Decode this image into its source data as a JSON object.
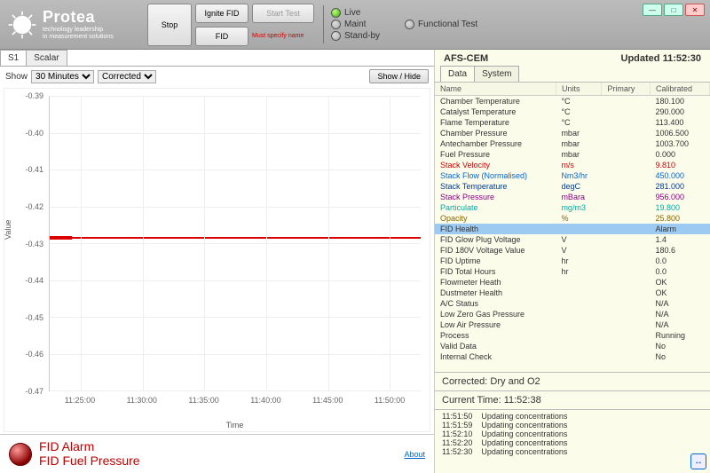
{
  "brand": {
    "title": "Protea",
    "sub1": "technology leadership",
    "sub2": "in measurement solutions"
  },
  "toolbar": {
    "stop": "Stop",
    "ignite": "Ignite FID",
    "start": "Start Test",
    "fid": "FID",
    "warn": "Must specify name"
  },
  "status": {
    "live": "Live",
    "maint": "Maint",
    "standby": "Stand-by",
    "func": "Functional Test"
  },
  "left": {
    "tabs": [
      "S1",
      "Scalar"
    ],
    "show_label": "Show",
    "time_range": "30 Minutes",
    "correction": "Corrected",
    "showhide": "Show / Hide",
    "about": "About"
  },
  "alarm": {
    "line1": "FID Alarm",
    "line2": "FID Fuel Pressure"
  },
  "chart_data": {
    "type": "line",
    "xlabel": "Time",
    "ylabel": "Value",
    "ylim": [
      -0.48,
      -0.39
    ],
    "yticks": [
      "-0.39",
      "-0.40",
      "-0.41",
      "-0.42",
      "-0.43",
      "-0.44",
      "-0.45",
      "-0.46",
      "-0.47"
    ],
    "xticks": [
      "11:25:00",
      "11:30:00",
      "11:35:00",
      "11:40:00",
      "11:45:00",
      "11:50:00"
    ],
    "series": [
      {
        "name": "S1",
        "color": "#d00",
        "constant_y": -0.433
      }
    ]
  },
  "right": {
    "title": "AFS-CEM",
    "updated_label": "Updated",
    "updated_time": "11:52:30",
    "tabs": [
      "Data",
      "System"
    ],
    "headers": [
      "Name",
      "Units",
      "Primary",
      "Calibrated"
    ],
    "rows": [
      {
        "n": "Chamber Temperature",
        "u": "°C",
        "v": "180.100",
        "cls": ""
      },
      {
        "n": "Catalyst Temperature",
        "u": "°C",
        "v": "290.000",
        "cls": ""
      },
      {
        "n": "Flame Temperature",
        "u": "°C",
        "v": "113.400",
        "cls": ""
      },
      {
        "n": "Chamber Pressure",
        "u": "mbar",
        "v": "1006.500",
        "cls": ""
      },
      {
        "n": "Antechamber Pressure",
        "u": "mbar",
        "v": "1003.700",
        "cls": ""
      },
      {
        "n": "Fuel Pressure",
        "u": "mbar",
        "v": "0.000",
        "cls": ""
      },
      {
        "n": "Stack Velocity",
        "u": "m/s",
        "v": "9.810",
        "cls": "c-red"
      },
      {
        "n": "Stack Flow (Normalised)",
        "u": "Nm3/hr",
        "v": "450.000",
        "cls": "c-blue"
      },
      {
        "n": "Stack Temperature",
        "u": "degC",
        "v": "281.000",
        "cls": "c-navy"
      },
      {
        "n": "Stack Pressure",
        "u": "mBara",
        "v": "956.000",
        "cls": "c-purple"
      },
      {
        "n": "Particulate",
        "u": "mg/m3",
        "v": "19.800",
        "cls": "c-teal"
      },
      {
        "n": "Opacity",
        "u": "%",
        "v": "25.800",
        "cls": "c-brown"
      },
      {
        "n": "FID Health",
        "u": "",
        "v": "Alarm",
        "cls": "",
        "sel": true
      },
      {
        "n": "FID Glow Plug Voltage",
        "u": "V",
        "v": "1.4",
        "cls": ""
      },
      {
        "n": "FID 180V Voltage Value",
        "u": "V",
        "v": "180.6",
        "cls": ""
      },
      {
        "n": "FID Uptime",
        "u": "hr",
        "v": "0.0",
        "cls": ""
      },
      {
        "n": "FID Total Hours",
        "u": "hr",
        "v": "0.0",
        "cls": ""
      },
      {
        "n": "Flowmeter Heath",
        "u": "",
        "v": "OK",
        "cls": ""
      },
      {
        "n": "Dustmeter Health",
        "u": "",
        "v": "OK",
        "cls": ""
      },
      {
        "n": "A/C Status",
        "u": "",
        "v": "N/A",
        "cls": ""
      },
      {
        "n": "Low Zero Gas Pressure",
        "u": "",
        "v": "N/A",
        "cls": ""
      },
      {
        "n": "Low Air Pressure",
        "u": "",
        "v": "N/A",
        "cls": ""
      },
      {
        "n": "Process",
        "u": "",
        "v": "Running",
        "cls": ""
      },
      {
        "n": "Valid Data",
        "u": "",
        "v": "No",
        "cls": ""
      },
      {
        "n": "Internal Check",
        "u": "",
        "v": "No",
        "cls": ""
      }
    ],
    "corrected": "Corrected: Dry and O2",
    "current_time_label": "Current Time:",
    "current_time": "11:52:38",
    "log": [
      {
        "t": "11:51:50",
        "m": "Updating concentrations"
      },
      {
        "t": "11:51:59",
        "m": "Updating concentrations"
      },
      {
        "t": "11:52:10",
        "m": "Updating concentrations"
      },
      {
        "t": "11:52:20",
        "m": "Updating concentrations"
      },
      {
        "t": "11:52:30",
        "m": "Updating concentrations"
      }
    ]
  }
}
